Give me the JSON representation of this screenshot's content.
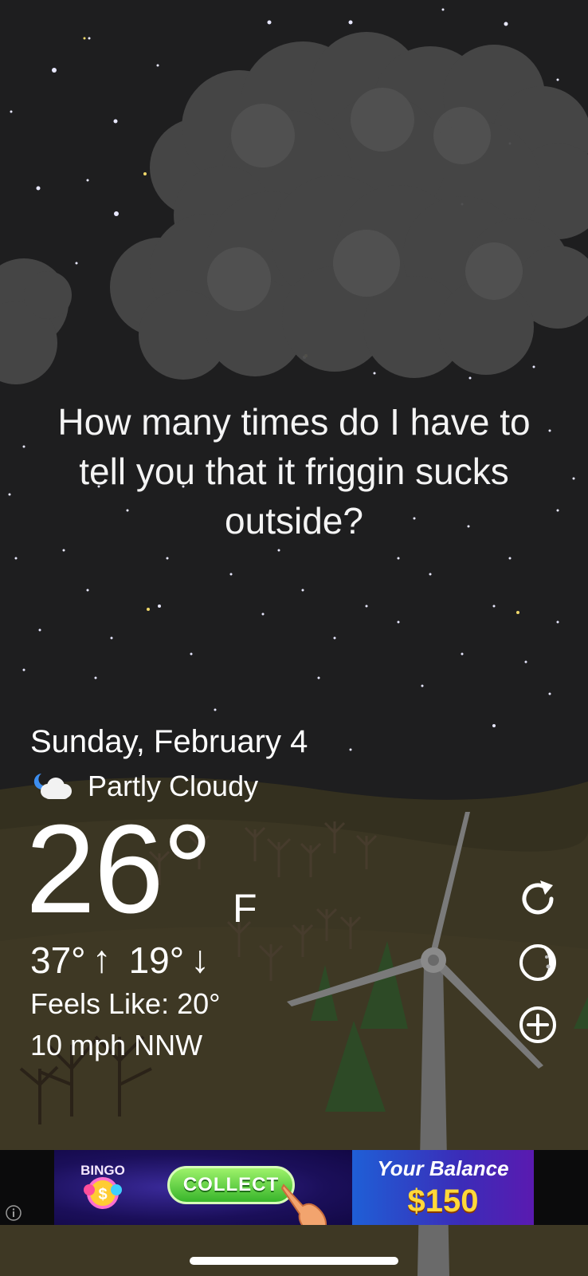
{
  "message": {
    "line1": "How many times do I have to",
    "line2": "tell you that it friggin sucks",
    "line3": "outside?"
  },
  "weather": {
    "date": "Sunday, February 4",
    "condition": "Partly Cloudy",
    "condition_icon": "partly-cloudy-night-icon",
    "temperature": "26°",
    "unit": "F",
    "high": "37°",
    "high_arrow": "↑",
    "low": "19°",
    "low_arrow": "↓",
    "feels_like": "Feels Like: 20°",
    "wind": "10 mph NNW"
  },
  "side_buttons": [
    "refresh-icon",
    "moon-phase-icon",
    "add-icon"
  ],
  "ad": {
    "bingo_label": "BINGO",
    "collect_label": "COLLECT",
    "balance_label": "Your Balance",
    "balance_value": "$150"
  },
  "colors": {
    "sky": "#1e1e1f",
    "ground": "#3a3522",
    "cloud": "#4a4a4a",
    "accent_green": "#38b52b",
    "balance_yellow": "#ffd83a"
  }
}
